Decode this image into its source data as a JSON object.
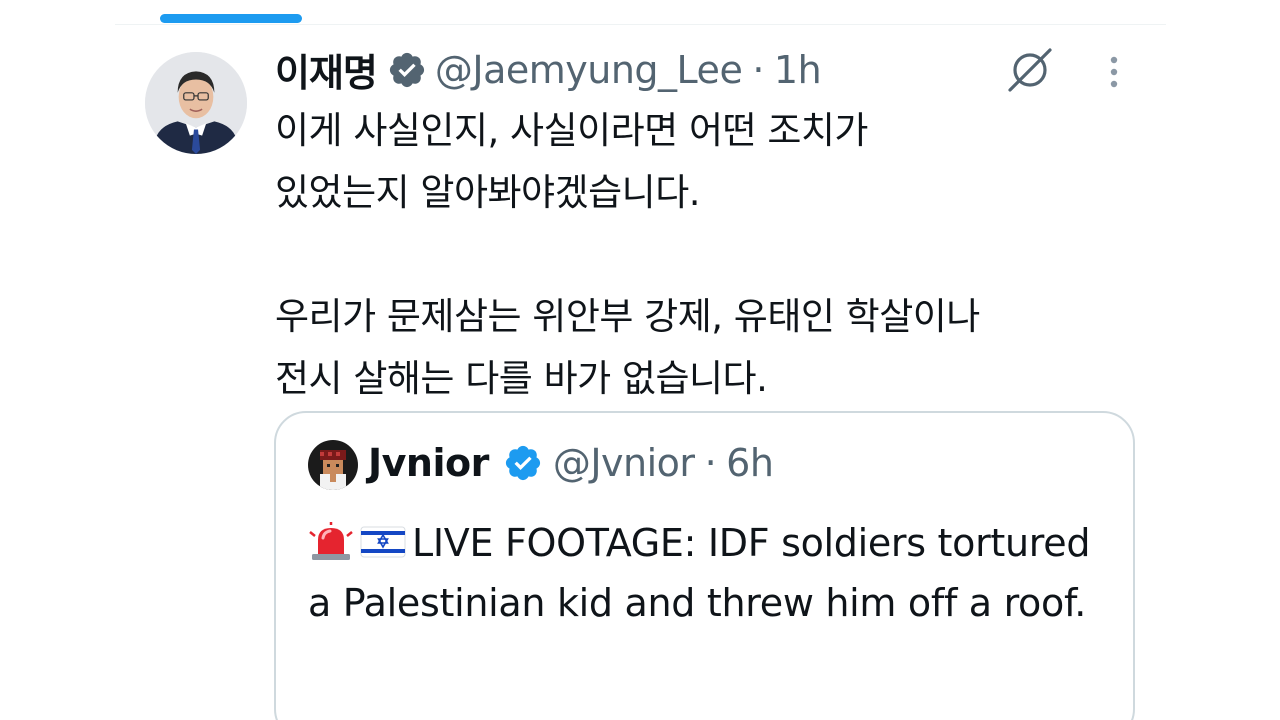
{
  "tweet": {
    "author_name": "이재명",
    "handle": "@Jaemyung_Lee",
    "separator": "·",
    "time": "1h",
    "text": "이게 사실인지, 사실이라면 어떤 조치가\n있었는지 알아봐야겠습니다.\n\n우리가 문제삼는 위안부 강제, 유태인 학살이나\n전시 살해는 다를 바가 없습니다."
  },
  "quoted_tweet": {
    "author_name": "Jvnior",
    "handle": "@Jvnior",
    "separator": "·",
    "time": "6h",
    "text": "LIVE FOOTAGE: IDF soldiers tortured a Palestinian kid and threw him off a roof."
  },
  "icons": {
    "verified": "verified-badge-icon",
    "grok": "grok-icon",
    "more": "more-vertical-icon",
    "siren_emoji": "police-light-emoji",
    "flag_emoji": "israel-flag-emoji"
  },
  "colors": {
    "accent": "#1d9bf0",
    "verified": "#1d9bf0",
    "secondary_text": "#536471",
    "border": "#cfd9de"
  }
}
